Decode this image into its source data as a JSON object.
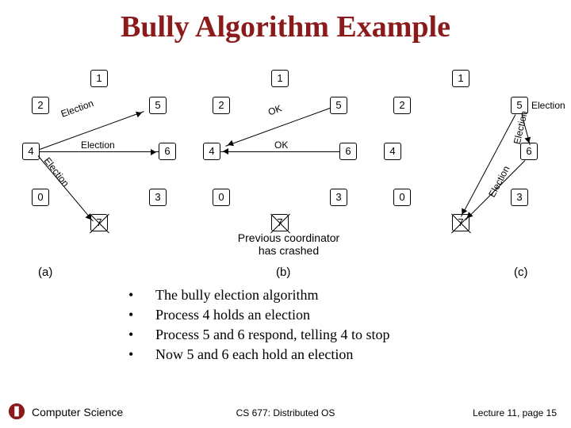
{
  "title": "Bully Algorithm Example",
  "diagram": {
    "nodes": [
      "0",
      "1",
      "2",
      "3",
      "4",
      "5",
      "6",
      "7"
    ],
    "crashed_node": "7",
    "crash_note": "Previous coordinator has crashed",
    "panels": [
      {
        "id": "a",
        "label": "(a)",
        "messages": [
          {
            "from": "4",
            "to": "5",
            "text": "Election"
          },
          {
            "from": "4",
            "to": "6",
            "text": "Election"
          },
          {
            "from": "4",
            "to": "7",
            "text": "Election"
          }
        ]
      },
      {
        "id": "b",
        "label": "(b)",
        "messages": [
          {
            "from": "5",
            "to": "4",
            "text": "OK"
          },
          {
            "from": "6",
            "to": "4",
            "text": "OK"
          }
        ]
      },
      {
        "id": "c",
        "label": "(c)",
        "messages": [
          {
            "from": "5",
            "to": "6",
            "text": "Election"
          },
          {
            "from": "6",
            "to": "7",
            "text": "Election"
          },
          {
            "from": "5",
            "to": "7",
            "text": "Election"
          }
        ]
      }
    ]
  },
  "bullets": [
    "The bully election algorithm",
    "Process 4 holds an election",
    "Process 5 and 6 respond, telling 4 to stop",
    "Now 5 and 6 each hold an election"
  ],
  "footer": {
    "left": "Computer Science",
    "center": "CS 677: Distributed OS",
    "right": "Lecture 11, page 15"
  }
}
